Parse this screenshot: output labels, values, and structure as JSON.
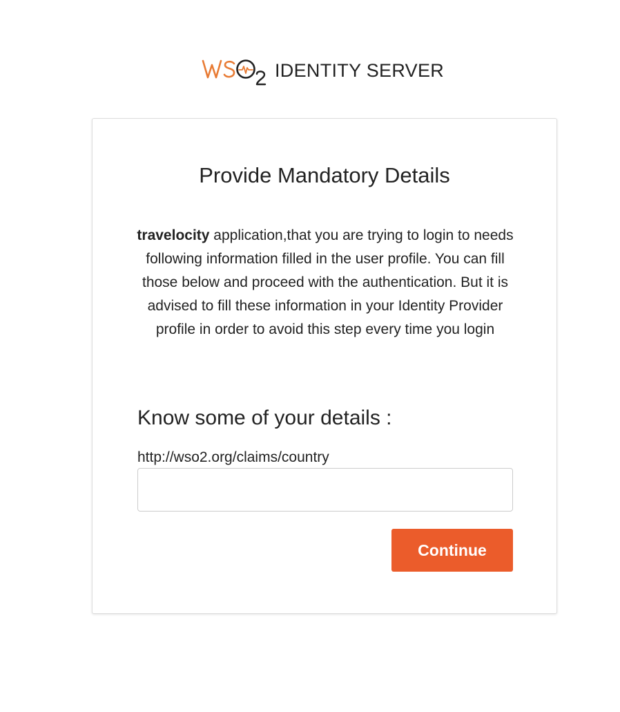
{
  "header": {
    "logo": {
      "mark_text": "WSO2",
      "product_name": "IDENTITY SERVER"
    }
  },
  "card": {
    "title": "Provide Mandatory Details",
    "description": {
      "app_name": "travelocity",
      "text": " application,that you are trying to login to needs following information filled in the user profile. You can fill those below and proceed with the authentication. But it is advised to fill these information in your Identity Provider profile in order to avoid this step every time you login"
    },
    "section_heading": "Know some of your details :",
    "fields": [
      {
        "label": "http://wso2.org/claims/country",
        "value": "",
        "placeholder": ""
      }
    ],
    "continue_label": "Continue"
  },
  "colors": {
    "brand_orange": "#eb5c2b",
    "logo_orange": "#e87b34",
    "text": "#222222",
    "card_border": "#dedede",
    "input_border": "#cccccc"
  }
}
